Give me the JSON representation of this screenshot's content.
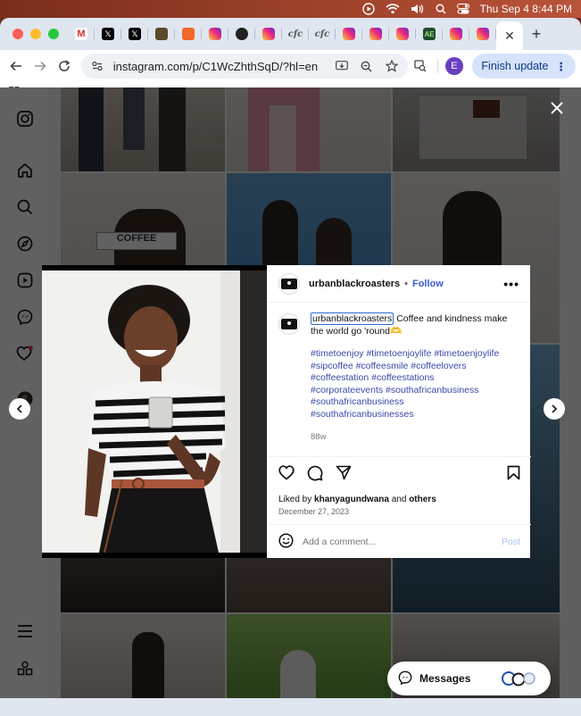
{
  "menubar": {
    "datetime": "Thu Sep 4  8:44 PM"
  },
  "browser": {
    "tabs": [
      {
        "icon": "gmail-icon",
        "glyph": "M"
      },
      {
        "icon": "x-icon",
        "glyph": "𝕏"
      },
      {
        "icon": "x-icon",
        "glyph": "𝕏"
      },
      {
        "icon": "square-app-icon",
        "glyph": ""
      },
      {
        "icon": "orange-app-icon",
        "glyph": ""
      },
      {
        "icon": "instagram-icon",
        "glyph": ""
      },
      {
        "icon": "github-icon",
        "glyph": ""
      },
      {
        "icon": "instagram-icon",
        "glyph": ""
      },
      {
        "icon": "cfc-icon",
        "glyph": "cfc"
      },
      {
        "icon": "cfc-icon",
        "glyph": "cfc"
      },
      {
        "icon": "instagram-icon",
        "glyph": ""
      },
      {
        "icon": "instagram-icon",
        "glyph": ""
      },
      {
        "icon": "instagram-icon",
        "glyph": ""
      },
      {
        "icon": "ae-icon",
        "glyph": "AE"
      },
      {
        "icon": "instagram-icon",
        "glyph": ""
      },
      {
        "icon": "instagram-icon",
        "glyph": ""
      }
    ],
    "active_tab_close": "✕",
    "new_tab": "+",
    "url": "instagram.com/p/C1WcZhthSqD/?hl=en",
    "profile_initial": "E",
    "finish_update": "Finish update"
  },
  "post": {
    "username": "urbanblackroasters",
    "dot": "•",
    "follow": "Follow",
    "caption_user": "urbanblackroasters",
    "caption_text": " Coffee and kindness make the world go 'round🫶",
    "hashtags": [
      "#timetoenjoy #timetoenjoylife #timetoenjoylife",
      "#sipcoffee #coffeesmile #coffeelovers",
      "#coffeestation #coffeestations",
      "#corporateevents #southafricanbusiness",
      "#southafricanbusiness",
      "#southafricanbusinesses"
    ],
    "age": "88w",
    "liked_prefix": "Liked by ",
    "liked_user": "khanyagundwana",
    "liked_mid": " and ",
    "liked_others": "others",
    "date": "December 27, 2023",
    "comment_placeholder": "Add a comment...",
    "post_button": "Post"
  },
  "messages": {
    "label": "Messages"
  },
  "colors": {
    "accent_blue": "#3b5bdb",
    "hashtag_blue": "#3949ab",
    "finish_update_bg": "#d7e3fb"
  }
}
